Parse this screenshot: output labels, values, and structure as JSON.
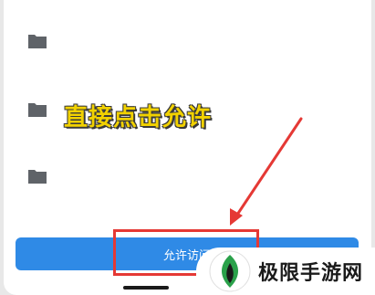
{
  "folders": [
    {
      "icon": "folder-icon"
    },
    {
      "icon": "folder-icon"
    },
    {
      "icon": "folder-icon"
    }
  ],
  "annotation": {
    "caption": "直接点击允许",
    "caption_color": "#f2d200",
    "highlight_color": "#e53935"
  },
  "allow_button": {
    "label": "允许访问",
    "color": "#2f8ae6"
  },
  "watermark": {
    "text": "极限手游网",
    "logo_icon": "leaf-logo-icon"
  }
}
